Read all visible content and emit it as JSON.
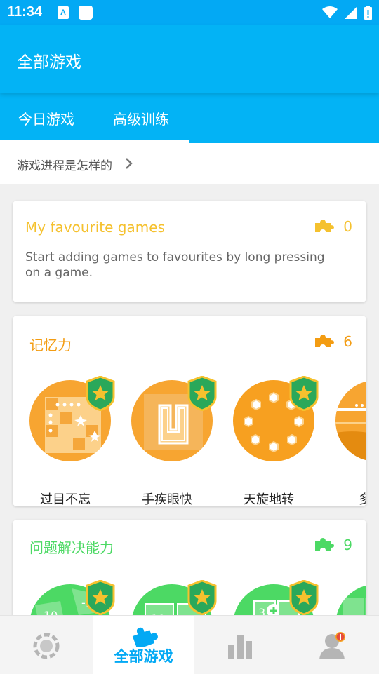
{
  "status_bar": {
    "time": "11:34",
    "notification_letter": "A"
  },
  "app_bar": {
    "title": "全部游戏"
  },
  "tabs": [
    {
      "label": "今日游戏",
      "active": true
    },
    {
      "label": "高级训练",
      "active": false
    }
  ],
  "progress_link": {
    "label": "游戏进程是怎样的"
  },
  "favourites": {
    "title": "My favourite games",
    "count": "0",
    "description": "Start adding games to favourites by long pressing on a game.",
    "color": "#f5c12e"
  },
  "sections": [
    {
      "title": "记忆力",
      "count": "6",
      "color": "#f39c12",
      "games": [
        {
          "label": "过目不忘",
          "icon": "grid-stars-game-icon"
        },
        {
          "label": "手疾眼快",
          "icon": "u-shape-game-icon"
        },
        {
          "label": "天旋地转",
          "icon": "hexagon-ring-game-icon"
        },
        {
          "label": "多地",
          "icon": "landscape-game-icon"
        }
      ]
    },
    {
      "title": "问题解决能力",
      "count": "9",
      "color": "#4cd964",
      "games": [
        {
          "label": "",
          "icon": "number-tiles-game-icon"
        },
        {
          "label": "",
          "icon": "number-boxes-game-icon"
        },
        {
          "label": "",
          "icon": "plus-tiles-game-icon"
        },
        {
          "label": "",
          "icon": "green-blocks-game-icon"
        }
      ]
    }
  ],
  "bottom_nav": [
    {
      "name": "daily-icon",
      "label": ""
    },
    {
      "name": "all-games-icon",
      "label": "全部游戏",
      "active": true
    },
    {
      "name": "stats-icon",
      "label": ""
    },
    {
      "name": "profile-icon",
      "label": ""
    }
  ],
  "colors": {
    "primary": "#03b3f5",
    "memory": "#f39c12",
    "problem": "#4cd964",
    "favourite": "#f5c12e"
  }
}
